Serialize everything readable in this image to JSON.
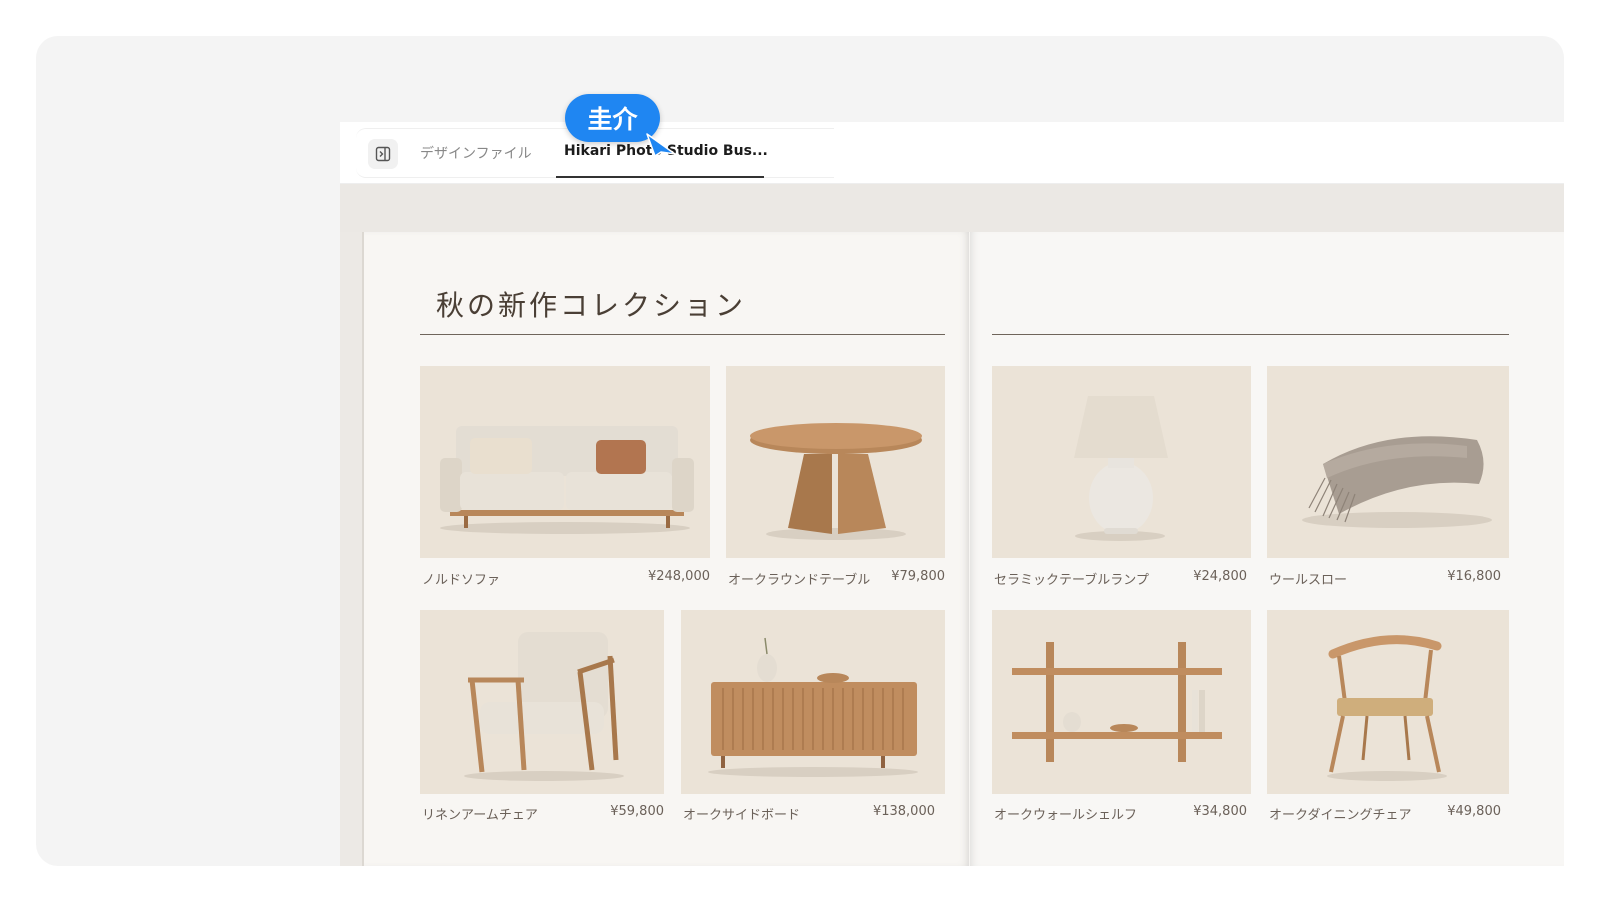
{
  "tabs": [
    {
      "label": "デザインファイル",
      "active": false
    },
    {
      "label": "Hikari Photo Studio Bus...",
      "active": true
    }
  ],
  "catalog": {
    "title": "秋の新作コレクション"
  },
  "products": [
    {
      "name": "ノルドソファ",
      "price": "¥248,000",
      "icon": "sofa-icon"
    },
    {
      "name": "オークラウンドテーブル",
      "price": "¥79,800",
      "icon": "round-table-icon"
    },
    {
      "name": "セラミックテーブルランプ",
      "price": "¥24,800",
      "icon": "table-lamp-icon"
    },
    {
      "name": "ウールスロー",
      "price": "¥16,800",
      "icon": "wool-throw-icon"
    },
    {
      "name": "リネンアームチェア",
      "price": "¥59,800",
      "icon": "armchair-icon"
    },
    {
      "name": "オークサイドボード",
      "price": "¥138,000",
      "icon": "sideboard-icon"
    },
    {
      "name": "オークウォールシェルフ",
      "price": "¥34,800",
      "icon": "wall-shelf-icon"
    },
    {
      "name": "オークダイニングチェア",
      "price": "¥49,800",
      "icon": "dining-chair-icon"
    }
  ],
  "collaborator": {
    "name": "圭介",
    "color": "#1f86f2"
  },
  "colors": {
    "paper": "#f8f6f3",
    "photo_bg": "#ebe3d7",
    "wood": "#b8875a",
    "fabric": "#ddd5c8"
  }
}
